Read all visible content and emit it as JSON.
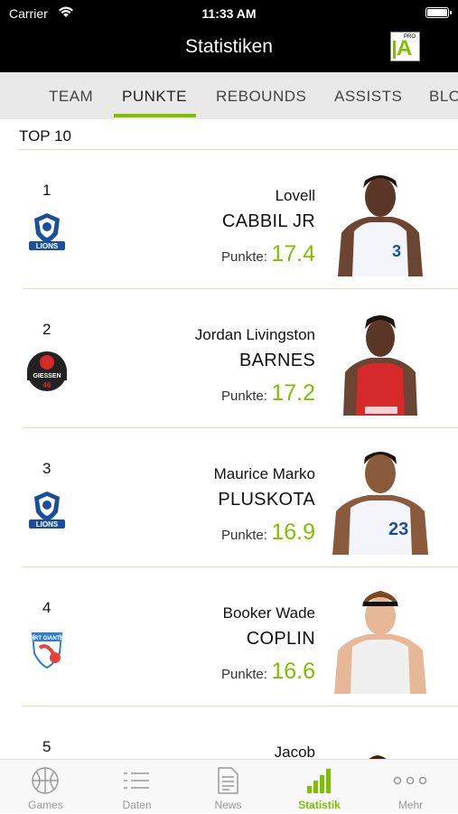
{
  "status_bar": {
    "carrier": "Carrier",
    "time": "11:33 AM"
  },
  "header": {
    "title": "Statistiken",
    "logo_small": "PRO",
    "logo_letter": "A"
  },
  "tabs": [
    {
      "label": "TEAM"
    },
    {
      "label": "PUNKTE"
    },
    {
      "label": "REBOUNDS"
    },
    {
      "label": "ASSISTS"
    },
    {
      "label": "BLOCKS"
    }
  ],
  "section": {
    "title": "TOP 10"
  },
  "stat_label": "Punkte:",
  "players": [
    {
      "rank": "1",
      "first": "Lovell",
      "last": "CABBIL JR",
      "value": "17.4",
      "team_text": "LIONS",
      "jersey_number": "3",
      "jersey_color": "#f3f5fb"
    },
    {
      "rank": "2",
      "first": "Jordan Livingston",
      "last": "BARNES",
      "value": "17.2",
      "team_text": "GIESSEN",
      "jersey_number": "",
      "jersey_color": "#d62a2a"
    },
    {
      "rank": "3",
      "first": "Maurice Marko",
      "last": "PLUSKOTA",
      "value": "16.9",
      "team_text": "LIONS",
      "jersey_number": "23",
      "jersey_color": "#f3f5fb"
    },
    {
      "rank": "4",
      "first": "Booker Wade",
      "last": "COPLIN",
      "value": "16.6",
      "team_text": "ART GIANTS",
      "jersey_number": "",
      "jersey_color": "#f0f0f0"
    },
    {
      "rank": "5",
      "first": "Jacob",
      "last": "",
      "value": "",
      "team_text": "",
      "jersey_number": "",
      "jersey_color": "#f0f0f0"
    }
  ],
  "tabbar": [
    {
      "label": "Games",
      "icon": "basketball-icon"
    },
    {
      "label": "Daten",
      "icon": "list-icon"
    },
    {
      "label": "News",
      "icon": "document-icon"
    },
    {
      "label": "Statistik",
      "icon": "bar-chart-icon",
      "active": true
    },
    {
      "label": "Mehr",
      "icon": "more-icon"
    }
  ],
  "colors": {
    "accent": "#7fbf00",
    "header_bg": "#000000",
    "tab_bg": "#e9e9e9"
  }
}
